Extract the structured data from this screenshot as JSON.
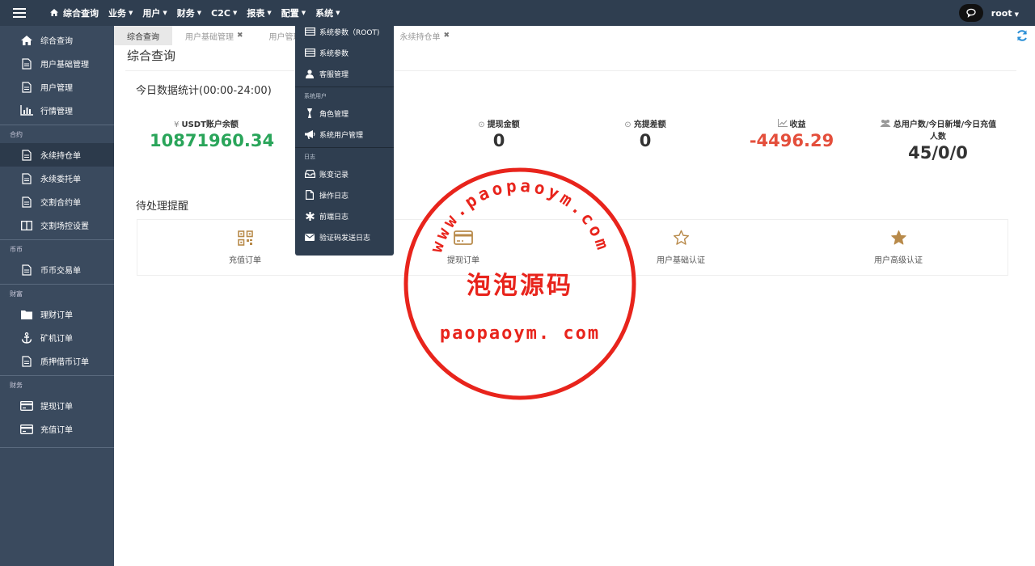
{
  "topbar": {
    "home_label": "综合查询",
    "nav": [
      "业务",
      "用户",
      "财务",
      "C2C",
      "报表",
      "配置",
      "系统"
    ],
    "user": "root"
  },
  "sidebar": {
    "items_top": [
      {
        "label": "综合查询",
        "icon": "home-icon"
      },
      {
        "label": "用户基础管理",
        "icon": "document-icon"
      },
      {
        "label": "用户管理",
        "icon": "document-icon"
      },
      {
        "label": "行情管理",
        "icon": "bar-chart-icon"
      }
    ],
    "section_contract": "合约",
    "items_contract": [
      {
        "label": "永续持仓单",
        "icon": "document-icon",
        "active": true
      },
      {
        "label": "永续委托单",
        "icon": "document-icon"
      },
      {
        "label": "交割合约单",
        "icon": "document-icon"
      },
      {
        "label": "交割场控设置",
        "icon": "columns-icon"
      }
    ],
    "section_coin": "币币",
    "items_coin": [
      {
        "label": "币币交易单",
        "icon": "document-icon"
      }
    ],
    "section_wealth": "财富",
    "items_wealth": [
      {
        "label": "理财订单",
        "icon": "folder-icon"
      },
      {
        "label": "矿机订单",
        "icon": "anchor-icon"
      },
      {
        "label": "质押借币订单",
        "icon": "document-icon"
      }
    ],
    "section_finance": "财务",
    "items_finance": [
      {
        "label": "提现订单",
        "icon": "credit-card-icon"
      },
      {
        "label": "充值订单",
        "icon": "credit-card-icon"
      }
    ]
  },
  "tabs": [
    {
      "label": "综合查询",
      "active": true,
      "closable": false
    },
    {
      "label": "用户基础管理",
      "closable": true
    },
    {
      "label": "用户管理",
      "closable": false
    },
    {
      "label": "永续持仓单",
      "closable": true
    }
  ],
  "main": {
    "title": "综合查询",
    "stats_title": "今日数据统计(00:00-24:00)",
    "stats": [
      {
        "icon": "¥",
        "label": "USDT账户余额",
        "value": "10871960.34",
        "color": "#2aa55a"
      },
      {
        "icon": "⊙",
        "label": "提现金额",
        "value": "0",
        "color": "#333333"
      },
      {
        "icon": "⊙",
        "label": "充提差额",
        "value": "0",
        "color": "#333333"
      },
      {
        "icon": "📈",
        "label": "收益",
        "value": "-4496.29",
        "color": "#e44f3c"
      },
      {
        "icon": "👥",
        "label": "总用户数/今日新增/今日充值",
        "label2": "人数",
        "value": "45/0/0",
        "color": "#333333"
      }
    ],
    "pending_title": "待处理提醒",
    "pending": [
      {
        "label": "充值订单",
        "icon": "qr-code-icon"
      },
      {
        "label": "提现订单",
        "icon": "credit-card-icon"
      },
      {
        "label": "用户基础认证",
        "icon": "star-outline-icon"
      },
      {
        "label": "用户高级认证",
        "icon": "star-filled-icon"
      }
    ]
  },
  "dropdown": {
    "items_a": [
      {
        "label": "系统参数（ROOT)",
        "icon": "table-icon"
      },
      {
        "label": "系统参数",
        "icon": "table-icon"
      },
      {
        "label": "客服管理",
        "icon": "user-icon"
      }
    ],
    "header_users": "系统用户",
    "items_b": [
      {
        "label": "角色管理",
        "icon": "role-icon"
      },
      {
        "label": "系统用户管理",
        "icon": "bullhorn-icon"
      }
    ],
    "header_logs": "日志",
    "items_c": [
      {
        "label": "账变记录",
        "icon": "inbox-icon"
      },
      {
        "label": "操作日志",
        "icon": "file-icon"
      },
      {
        "label": "前端日志",
        "icon": "asterisk-icon"
      },
      {
        "label": "验证码发送日志",
        "icon": "envelope-icon"
      }
    ]
  },
  "watermark": {
    "arc_text": "www.paopaoym.com",
    "name": "泡泡源码",
    "url": "paopaoym. com"
  },
  "colors": {
    "topbar": "#2f3e50",
    "sidebar": "#3a4a5e",
    "green": "#2aa55a",
    "red": "#e44f3c",
    "gold": "#b88a4a",
    "stamp": "#e8241c"
  }
}
